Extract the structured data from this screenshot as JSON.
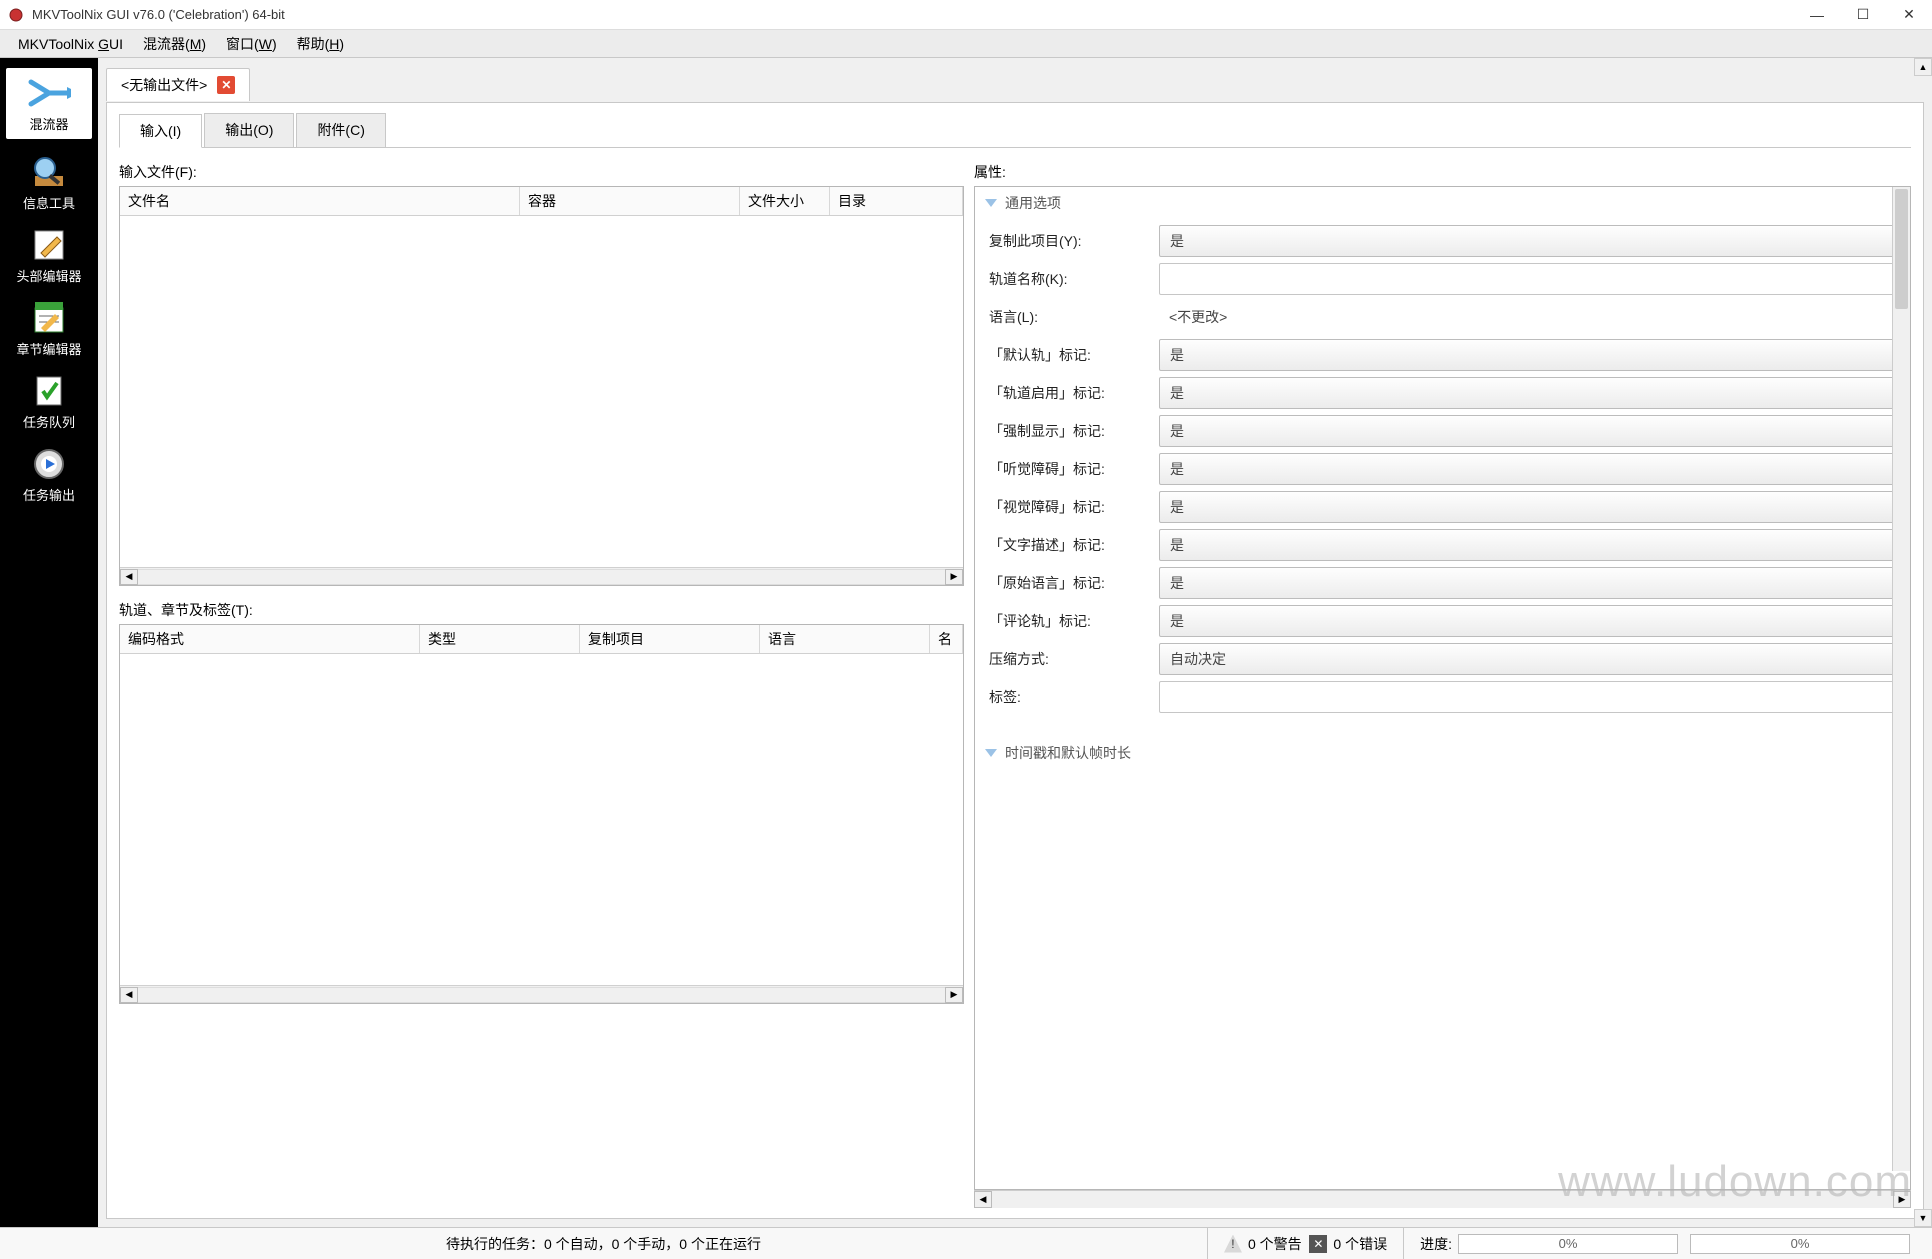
{
  "window": {
    "title": "MKVToolNix GUI v76.0 ('Celebration') 64-bit"
  },
  "menubar": {
    "app": "MKVToolNix GUI",
    "muxer": "混流器(M)",
    "window": "窗口(W)",
    "help": "帮助(H)"
  },
  "sidebar": {
    "items": [
      {
        "key": "muxer",
        "label": "混流器",
        "active": true
      },
      {
        "key": "info",
        "label": "信息工具",
        "active": false
      },
      {
        "key": "header",
        "label": "头部编辑器",
        "active": false
      },
      {
        "key": "chapter",
        "label": "章节编辑器",
        "active": false
      },
      {
        "key": "queue",
        "label": "任务队列",
        "active": false
      },
      {
        "key": "output",
        "label": "任务输出",
        "active": false
      }
    ]
  },
  "doc_tab": {
    "label": "<无输出文件>"
  },
  "subtabs": {
    "input": "输入(I)",
    "output": "输出(O)",
    "attachment": "附件(C)"
  },
  "labels": {
    "input_files": "输入文件(F):",
    "tracks": "轨道、章节及标签(T):",
    "properties": "属性:"
  },
  "files_table": {
    "headers": [
      "文件名",
      "容器",
      "文件大小",
      "目录"
    ]
  },
  "tracks_table": {
    "headers": [
      "编码格式",
      "类型",
      "复制项目",
      "语言",
      "名"
    ]
  },
  "props": {
    "group1_title": "通用选项",
    "group2_title": "时间戳和默认帧时长",
    "rows": [
      {
        "label": "复制此项目(Y):",
        "value": "是"
      },
      {
        "label": "轨道名称(K):",
        "value": ""
      },
      {
        "label": "语言(L):",
        "value": "<不更改>"
      },
      {
        "label": "「默认轨」标记:",
        "value": "是"
      },
      {
        "label": "「轨道启用」标记:",
        "value": "是"
      },
      {
        "label": "「强制显示」标记:",
        "value": "是"
      },
      {
        "label": "「听觉障碍」标记:",
        "value": "是"
      },
      {
        "label": "「视觉障碍」标记:",
        "value": "是"
      },
      {
        "label": "「文字描述」标记:",
        "value": "是"
      },
      {
        "label": "「原始语言」标记:",
        "value": "是"
      },
      {
        "label": "「评论轨」标记:",
        "value": "是"
      },
      {
        "label": "压缩方式:",
        "value": "自动决定"
      },
      {
        "label": "标签:",
        "value": ""
      }
    ]
  },
  "statusbar": {
    "tasks": "待执行的任务：0 个自动，0 个手动，0 个正在运行",
    "warnings": "0 个警告",
    "errors": "0 个错误",
    "progress_label": "进度:",
    "progress1": "0%",
    "progress2": "0%"
  },
  "watermark": "www.ludown.com"
}
